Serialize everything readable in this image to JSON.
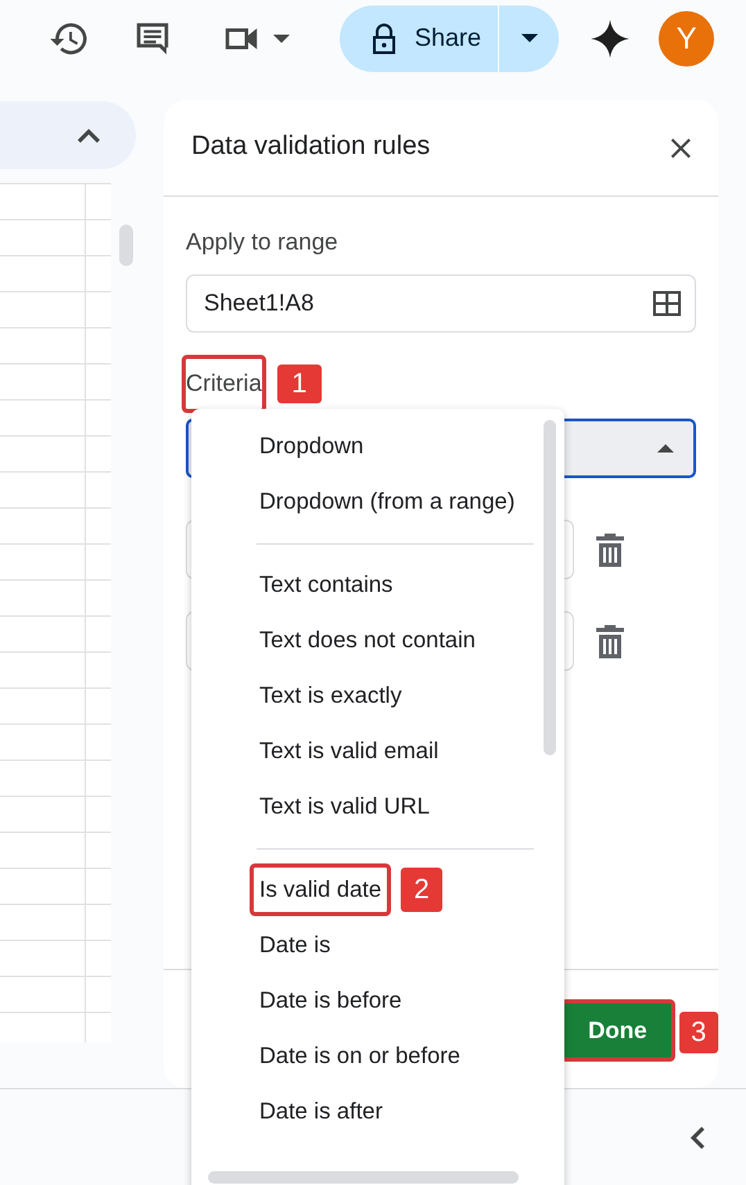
{
  "toolbar": {
    "share_label": "Share",
    "avatar_letter": "Y"
  },
  "panel": {
    "title": "Data validation rules",
    "apply_label": "Apply to range",
    "range_value": "Sheet1!A8",
    "criteria": {
      "label": "Criteria",
      "highlighted": true,
      "badge": "1"
    },
    "done": {
      "label": "Done",
      "highlighted": true,
      "badge": "3"
    }
  },
  "menu": {
    "items": [
      {
        "kind": "option",
        "label": "Dropdown",
        "highlighted": false
      },
      {
        "kind": "option",
        "label": "Dropdown (from a range)",
        "highlighted": false
      },
      {
        "kind": "separator"
      },
      {
        "kind": "option",
        "label": "Text contains",
        "highlighted": false
      },
      {
        "kind": "option",
        "label": "Text does not contain",
        "highlighted": false
      },
      {
        "kind": "option",
        "label": "Text is exactly",
        "highlighted": false
      },
      {
        "kind": "option",
        "label": "Text is valid email",
        "highlighted": false
      },
      {
        "kind": "option",
        "label": "Text is valid URL",
        "highlighted": false
      },
      {
        "kind": "separator"
      },
      {
        "kind": "option",
        "label": "Is valid date",
        "highlighted": true,
        "badge": "2"
      },
      {
        "kind": "option",
        "label": "Date is",
        "highlighted": false
      },
      {
        "kind": "option",
        "label": "Date is before",
        "highlighted": false
      },
      {
        "kind": "option",
        "label": "Date is on or before",
        "highlighted": false
      },
      {
        "kind": "option",
        "label": "Date is after",
        "highlighted": false
      }
    ]
  }
}
